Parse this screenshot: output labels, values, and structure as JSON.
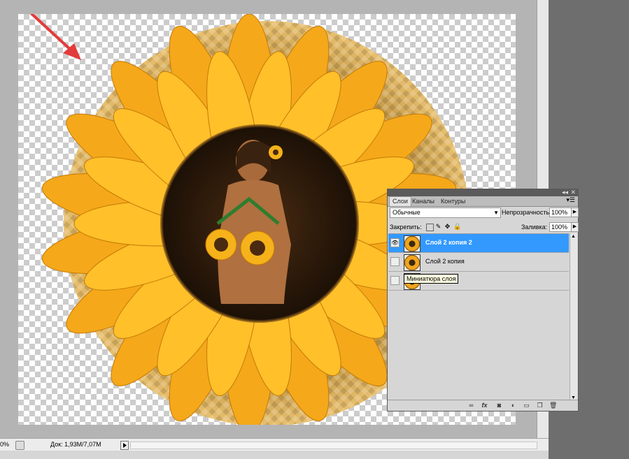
{
  "status_bar": {
    "zoom": "0%",
    "doc_info": "Док: 1,93M/7,07M"
  },
  "layers_panel": {
    "tabs": [
      {
        "label": "Слои",
        "active": true
      },
      {
        "label": "Каналы",
        "active": false
      },
      {
        "label": "Контуры",
        "active": false
      }
    ],
    "blend_mode": "Обычные",
    "opacity_label": "Непрозрачность:",
    "opacity_value": "100%",
    "lock_label": "Закрепить:",
    "fill_label": "Заливка:",
    "fill_value": "100%",
    "layers": [
      {
        "name": "Слой 2 копия 2",
        "selected": true,
        "visible": true
      },
      {
        "name": "Слой 2 копия",
        "selected": false,
        "visible": false
      },
      {
        "name": "",
        "selected": false,
        "visible": false
      }
    ],
    "tooltip": "Миниатюра слоя",
    "selection_color": "#3399ff"
  },
  "canvas": {
    "arrow_color": "#e23b3b",
    "petal_color": "#f5a81a",
    "center_color": "#2a1a0c"
  }
}
